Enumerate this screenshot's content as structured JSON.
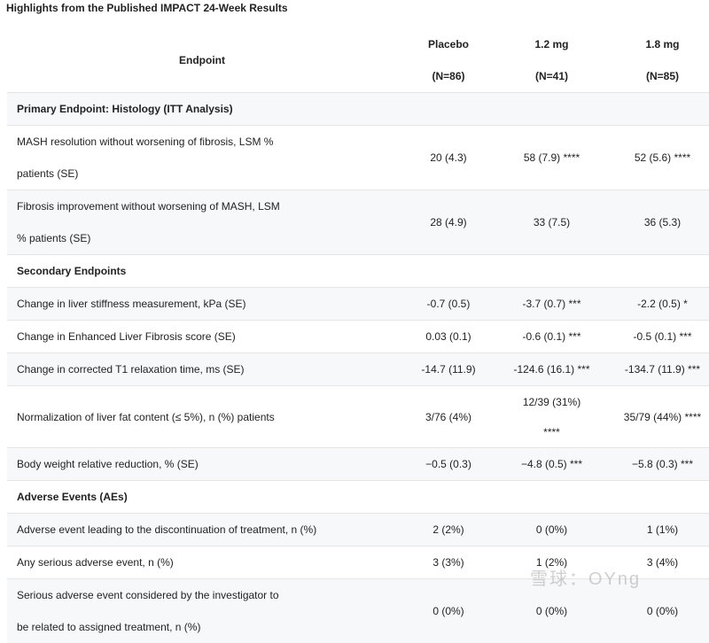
{
  "title": "Highlights from the Published IMPACT 24-Week Results",
  "header": {
    "endpoint": "Endpoint",
    "placebo": [
      "Placebo",
      "(N=86)"
    ],
    "low_dose": [
      "1.2 mg",
      "(N=41)"
    ],
    "high_dose": [
      "1.8 mg",
      "(N=85)"
    ]
  },
  "rows": [
    {
      "type": "section",
      "label": "Primary Endpoint: Histology (ITT Analysis)"
    },
    {
      "type": "data",
      "label": [
        "MASH resolution without worsening of fibrosis, LSM %",
        "patients (SE)"
      ],
      "values": [
        "20 (4.3)",
        "58 (7.9) ****",
        "52 (5.6) ****"
      ]
    },
    {
      "type": "data",
      "label": [
        "Fibrosis improvement without worsening of MASH, LSM",
        "% patients (SE)"
      ],
      "values": [
        "28 (4.9)",
        "33 (7.5)",
        "36 (5.3)"
      ]
    },
    {
      "type": "section",
      "label": "Secondary Endpoints"
    },
    {
      "type": "data",
      "label": [
        "Change in liver stiffness measurement, kPa (SE)"
      ],
      "values": [
        "-0.7 (0.5)",
        "-3.7 (0.7) ***",
        "-2.2 (0.5) *"
      ]
    },
    {
      "type": "data",
      "label": [
        "Change in Enhanced Liver Fibrosis score (SE)"
      ],
      "values": [
        "0.03 (0.1)",
        "-0.6 (0.1) ***",
        "-0.5 (0.1) ***"
      ]
    },
    {
      "type": "data",
      "label": [
        "Change in corrected T1 relaxation time, ms (SE)"
      ],
      "values": [
        "-14.7 (11.9)",
        "-124.6 (16.1) ***",
        "-134.7 (11.9) ***"
      ]
    },
    {
      "type": "data",
      "label": [
        "Normalization of liver fat content (≤ 5%), n (%) patients"
      ],
      "values": [
        "3/76 (4%)",
        [
          "12/39 (31%)",
          "****"
        ],
        "35/79 (44%) ****"
      ]
    },
    {
      "type": "data",
      "label": [
        "Body weight relative reduction, % (SE)"
      ],
      "values": [
        "−0.5 (0.3)",
        "−4.8 (0.5) ***",
        "−5.8 (0.3) ***"
      ]
    },
    {
      "type": "section",
      "label": "Adverse Events (AEs)"
    },
    {
      "type": "data",
      "label": [
        "Adverse event leading to the discontinuation of treatment, n (%)"
      ],
      "values": [
        "2 (2%)",
        "0 (0%)",
        "1 (1%)"
      ]
    },
    {
      "type": "data",
      "label": [
        "Any serious adverse event, n (%)"
      ],
      "values": [
        "3 (3%)",
        "1 (2%)",
        "3 (4%)"
      ]
    },
    {
      "type": "data",
      "label": [
        "Serious adverse event considered by the investigator to",
        "be related to assigned treatment, n (%)"
      ],
      "values": [
        "0 (0%)",
        "0 (0%)",
        "0 (0%)"
      ]
    }
  ],
  "watermark": "雪球：OYng"
}
